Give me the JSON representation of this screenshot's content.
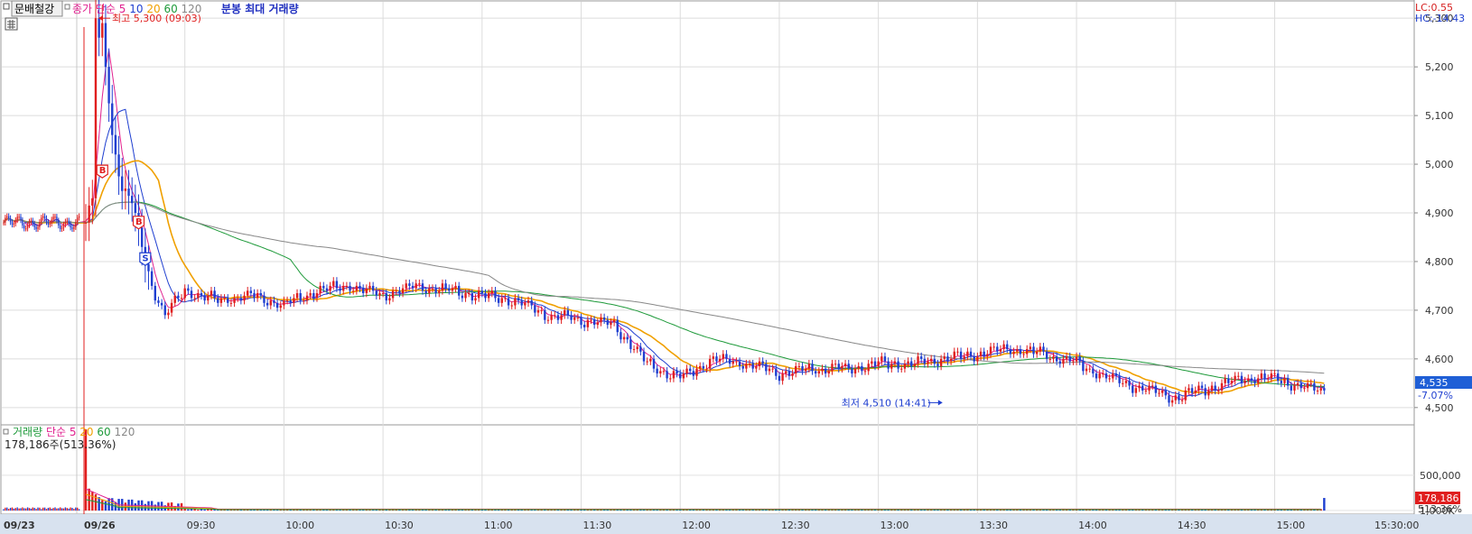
{
  "header": {
    "stock_name": "문배철강",
    "legend_price": [
      {
        "text": "종가 단순",
        "color": "#e0208f"
      },
      {
        "text": "5",
        "color": "#e0208f"
      },
      {
        "text": "10",
        "color": "#1f3fd0"
      },
      {
        "text": "20",
        "color": "#f0a000"
      },
      {
        "text": "60",
        "color": "#1e9a3a"
      },
      {
        "text": "120",
        "color": "#888888"
      }
    ],
    "chart_mode": "분봉 최대 거래량",
    "lc": "LC:0.55",
    "hc": "HC:-14.43"
  },
  "volume_legend": {
    "items": [
      {
        "text": "거래량",
        "color": "#1e9a3a"
      },
      {
        "text": "단순",
        "color": "#e0208f"
      },
      {
        "text": "5",
        "color": "#e0208f"
      },
      {
        "text": "20",
        "color": "#f0a000"
      },
      {
        "text": "60",
        "color": "#1e9a3a"
      },
      {
        "text": "120",
        "color": "#888888"
      }
    ],
    "current": "178,186주(513.36%)"
  },
  "annotations": {
    "high": "최고 5,300 (09:03)",
    "low": "최저 4,510 (14:41)",
    "markers": [
      "B",
      "B",
      "S"
    ]
  },
  "price_badge": {
    "price": "4,535",
    "change": "-7.07%"
  },
  "volume_badge": {
    "value": "178,186",
    "pct": "513.36%"
  },
  "chart_data": {
    "type": "candlestick",
    "price_axis": {
      "ticks": [
        "5,300",
        "5,200",
        "5,100",
        "5,000",
        "4,900",
        "4,800",
        "4,700",
        "4,600",
        "4,500"
      ],
      "range": [
        4470,
        5330
      ]
    },
    "volume_axis": {
      "ticks": [
        "1,000K",
        "500,000"
      ],
      "range": [
        0,
        1200000
      ]
    },
    "x_ticks": [
      "09/23",
      "09/26",
      "09:30",
      "10:00",
      "10:30",
      "11:00",
      "11:30",
      "12:00",
      "12:30",
      "13:00",
      "13:30",
      "14:00",
      "14:30",
      "15:00",
      "15:30:00"
    ],
    "prev_day_close": 4880,
    "intraday_close_path": [
      [
        0,
        4880
      ],
      [
        3,
        4950
      ],
      [
        5,
        5280
      ],
      [
        8,
        5060
      ],
      [
        11,
        4950
      ],
      [
        14,
        4920
      ],
      [
        17,
        4830
      ],
      [
        20,
        4750
      ],
      [
        24,
        4690
      ],
      [
        30,
        4740
      ],
      [
        40,
        4720
      ],
      [
        50,
        4730
      ],
      [
        60,
        4710
      ],
      [
        70,
        4740
      ],
      [
        80,
        4750
      ],
      [
        90,
        4730
      ],
      [
        100,
        4750
      ],
      [
        110,
        4740
      ],
      [
        120,
        4730
      ],
      [
        130,
        4720
      ],
      [
        140,
        4690
      ],
      [
        150,
        4680
      ],
      [
        160,
        4670
      ],
      [
        170,
        4590
      ],
      [
        180,
        4560
      ],
      [
        190,
        4600
      ],
      [
        200,
        4590
      ],
      [
        210,
        4570
      ],
      [
        220,
        4580
      ],
      [
        230,
        4580
      ],
      [
        240,
        4590
      ],
      [
        250,
        4590
      ],
      [
        260,
        4600
      ],
      [
        270,
        4610
      ],
      [
        280,
        4620
      ],
      [
        290,
        4610
      ],
      [
        300,
        4590
      ],
      [
        310,
        4560
      ],
      [
        320,
        4540
      ],
      [
        330,
        4520
      ],
      [
        340,
        4540
      ],
      [
        350,
        4560
      ],
      [
        360,
        4560
      ],
      [
        370,
        4540
      ],
      [
        375,
        4535
      ]
    ],
    "ma_periods": [
      5,
      10,
      20,
      60,
      120
    ],
    "high": 5300,
    "low": 4510,
    "last_close": 4535,
    "last_volume": 178186
  }
}
